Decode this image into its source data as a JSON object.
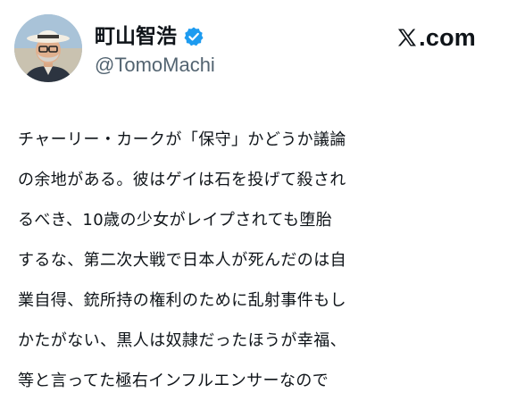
{
  "author": {
    "display_name": "町山智浩",
    "handle": "@TomoMachi",
    "verified_icon": "verified-badge",
    "avatar_icon": "profile-photo"
  },
  "brand": {
    "logo_icon": "x-logo",
    "text": ".com"
  },
  "tweet": {
    "lines": [
      "チャーリー・カークが「保守」かどうか議論",
      "の余地がある。彼はゲイは石を投げて殺され",
      "るべき、10歳の少女がレイプされても堕胎",
      "するな、第二次大戦で日本人が死んだのは自",
      "業自得、銃所持の権利のために乱射事件もし",
      "かたがない、黒人は奴隷だったほうが幸福、",
      "等と言ってた極右インフルエンサーなので"
    ]
  },
  "colors": {
    "text_primary": "#0f1419",
    "text_secondary": "#536471",
    "verified_blue": "#1d9bf0",
    "background": "#ffffff"
  }
}
